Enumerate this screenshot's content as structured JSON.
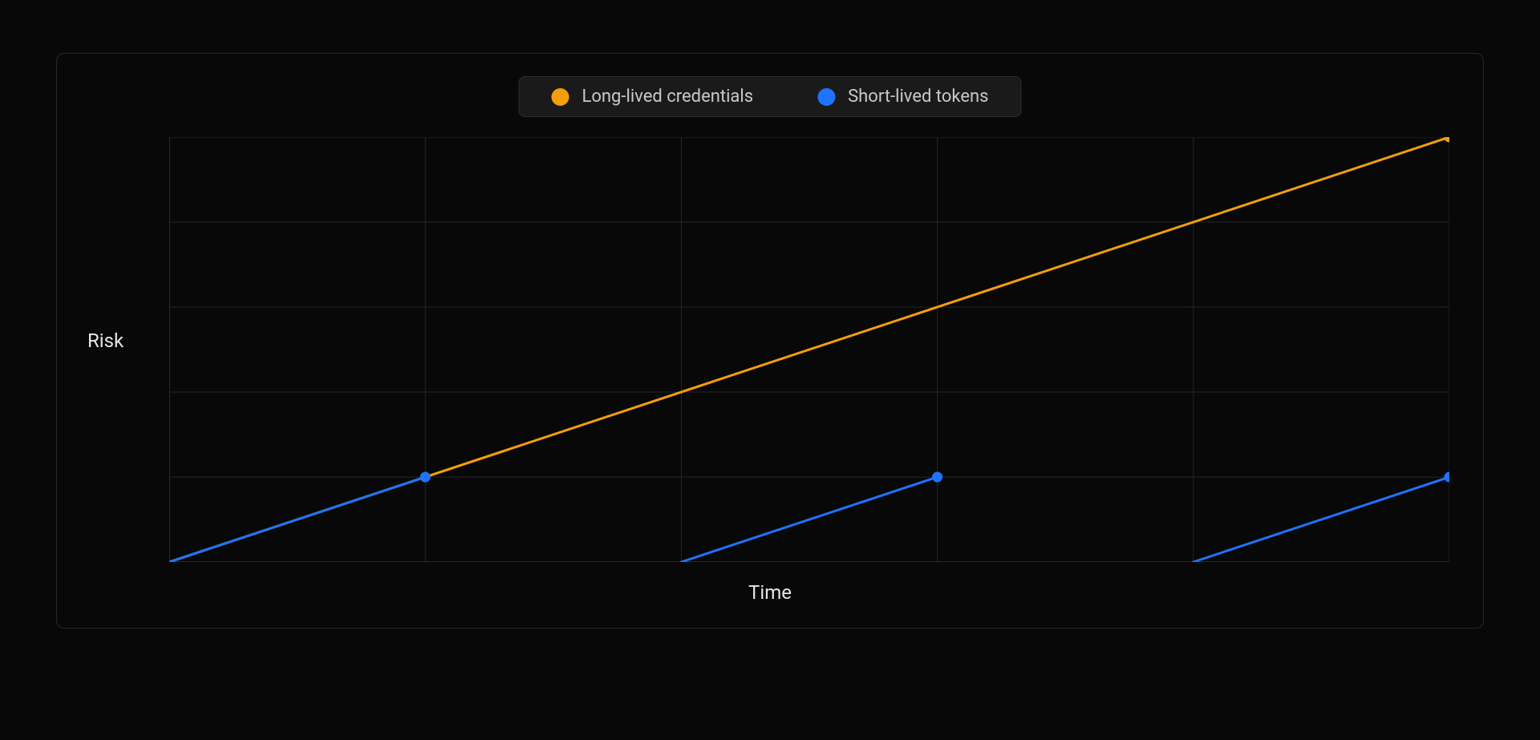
{
  "chart_data": {
    "type": "line",
    "xlabel": "Time",
    "ylabel": "Risk",
    "xlim": [
      0,
      5
    ],
    "ylim": [
      0,
      5
    ],
    "grid": true,
    "legend_position": "top",
    "series": [
      {
        "name": "Long-lived credentials",
        "color": "#f59e0b",
        "segments": [
          {
            "points": [
              [
                0,
                0
              ],
              [
                5,
                5
              ]
            ],
            "end_marker": true
          }
        ]
      },
      {
        "name": "Short-lived tokens",
        "color": "#1e74ff",
        "segments": [
          {
            "points": [
              [
                0,
                0
              ],
              [
                1,
                1
              ]
            ],
            "end_marker": true
          },
          {
            "points": [
              [
                2,
                0
              ],
              [
                3,
                1
              ]
            ],
            "end_marker": true
          },
          {
            "points": [
              [
                4,
                0
              ],
              [
                5,
                1
              ]
            ],
            "end_marker": true
          }
        ]
      }
    ]
  }
}
